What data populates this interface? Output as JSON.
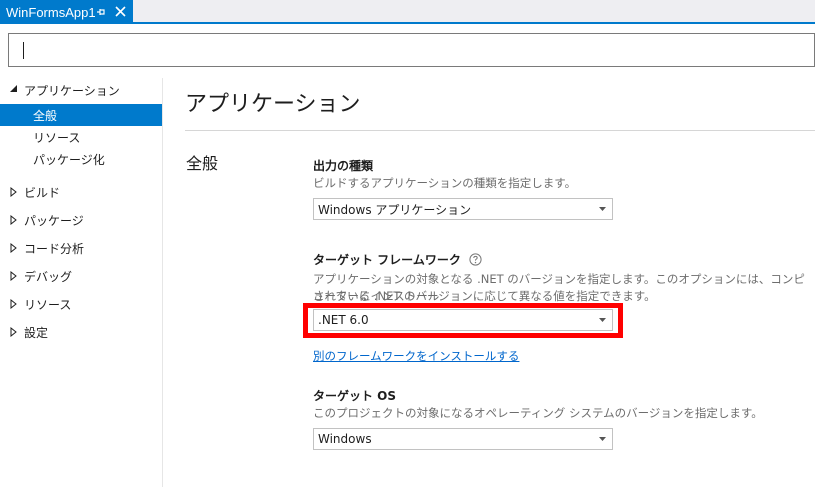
{
  "tab": {
    "title": "WinFormsApp1"
  },
  "search": {
    "value": ""
  },
  "nav": {
    "items": [
      {
        "label": "アプリケーション",
        "expanded": true
      },
      {
        "label": "全般",
        "selected": true
      },
      {
        "label": "リソース"
      },
      {
        "label": "パッケージ化"
      },
      {
        "label": "ビルド"
      },
      {
        "label": "パッケージ"
      },
      {
        "label": "コード分析"
      },
      {
        "label": "デバッグ"
      },
      {
        "label": "リソース"
      },
      {
        "label": "設定"
      }
    ]
  },
  "main": {
    "title": "アプリケーション",
    "section": "全般",
    "output_type": {
      "title": "出力の種類",
      "desc": "ビルドするアプリケーションの種類を指定します。",
      "value": "Windows アプリケーション"
    },
    "target_framework": {
      "title": "ターゲット フレームワーク",
      "desc_line1": "アプリケーションの対象となる .NET のバージョンを指定します。このオプションには、コンピューターにインストール",
      "desc_line2": "されている .NET のバージョンに応じて異なる値を指定できます。",
      "value": ".NET 6.0",
      "link": "別のフレームワークをインストールする"
    },
    "target_os": {
      "title": "ターゲット OS",
      "desc": "このプロジェクトの対象になるオペレーティング システムのバージョンを指定します。",
      "value": "Windows"
    }
  },
  "colors": {
    "accent": "#007acc",
    "highlight": "#ff0000",
    "link": "#0066cc"
  }
}
